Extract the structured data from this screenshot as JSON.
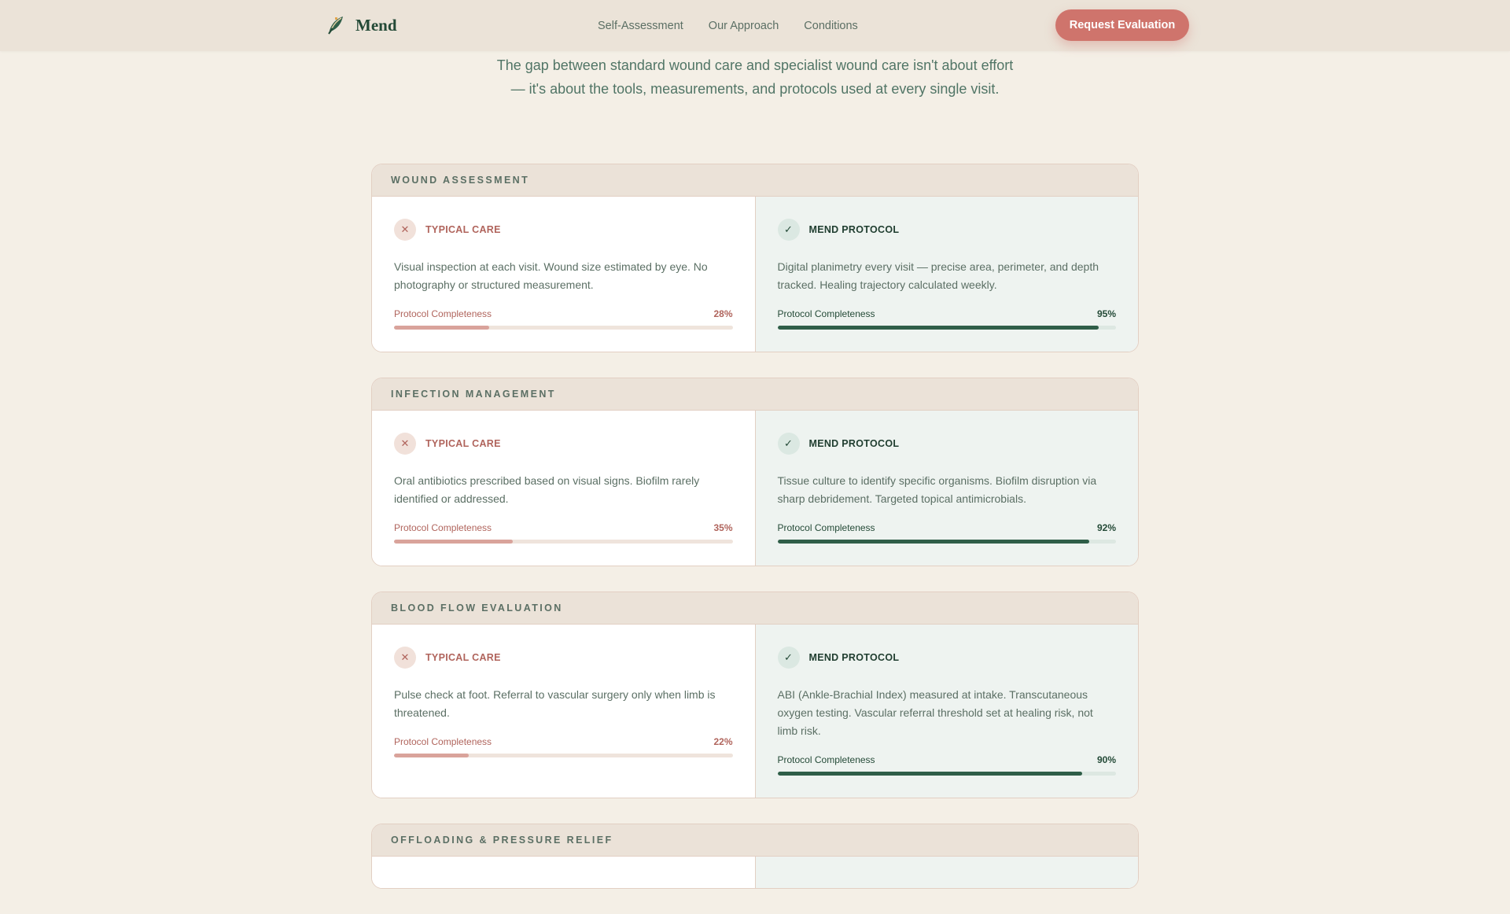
{
  "header": {
    "brand": "Mend",
    "nav": [
      "Self-Assessment",
      "Our Approach",
      "Conditions"
    ],
    "cta": "Request Evaluation"
  },
  "intro": {
    "line1": "The gap between standard wound care and specialist wound care isn't about effort",
    "line2": "— it's about the tools, measurements, and protocols used at every single visit."
  },
  "labels": {
    "typical": "TYPICAL CARE",
    "mend": "MEND PROTOCOL",
    "metric": "Protocol Completeness"
  },
  "colors": {
    "background": "#f4efe6",
    "accent": "#cf746c",
    "brand_green": "#244a37",
    "typical": "#b0645c",
    "mend_bar": "#2f5e48"
  },
  "icons": {
    "logo": "leaf-icon",
    "typical": "close-icon",
    "mend": "check-icon"
  },
  "sections": [
    {
      "title": "WOUND ASSESSMENT",
      "typical": {
        "text": "Visual inspection at each visit. Wound size estimated by eye. No photography or structured measurement.",
        "value": "28%",
        "fraction": 0.28
      },
      "mend": {
        "text": "Digital planimetry every visit — precise area, perimeter, and depth tracked. Healing trajectory calculated weekly.",
        "value": "95%",
        "fraction": 0.95
      }
    },
    {
      "title": "INFECTION MANAGEMENT",
      "typical": {
        "text": "Oral antibiotics prescribed based on visual signs. Biofilm rarely identified or addressed.",
        "value": "35%",
        "fraction": 0.35
      },
      "mend": {
        "text": "Tissue culture to identify specific organisms. Biofilm disruption via sharp debridement. Targeted topical antimicrobials.",
        "value": "92%",
        "fraction": 0.92
      }
    },
    {
      "title": "BLOOD FLOW EVALUATION",
      "typical": {
        "text": "Pulse check at foot. Referral to vascular surgery only when limb is threatened.",
        "value": "22%",
        "fraction": 0.22
      },
      "mend": {
        "text": "ABI (Ankle-Brachial Index) measured at intake. Transcutaneous oxygen testing. Vascular referral threshold set at healing risk, not limb risk.",
        "value": "90%",
        "fraction": 0.9
      }
    },
    {
      "title": "OFFLOADING & PRESSURE RELIEF"
    }
  ]
}
